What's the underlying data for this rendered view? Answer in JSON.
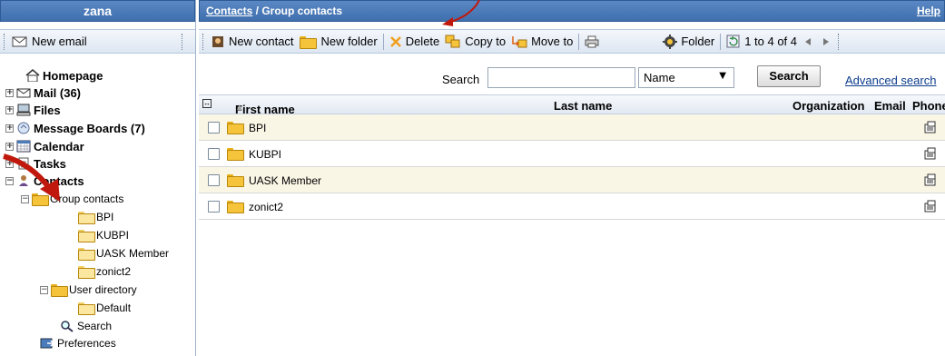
{
  "left_panel": {
    "brand": "zana",
    "toolbar": {
      "new_email": "New email"
    },
    "tree": [
      {
        "label": "Homepage"
      },
      {
        "label": "Mail (36)"
      },
      {
        "label": "Files"
      },
      {
        "label": "Message Boards (7)"
      },
      {
        "label": "Calendar"
      },
      {
        "label": "Tasks"
      },
      {
        "label": "Contacts"
      },
      {
        "label": "Group contacts"
      },
      {
        "label": "BPI"
      },
      {
        "label": "KUBPI"
      },
      {
        "label": "UASK Member"
      },
      {
        "label": "zonict2"
      },
      {
        "label": "User directory"
      },
      {
        "label": "Default"
      },
      {
        "label": "Search"
      },
      {
        "label": "Preferences"
      }
    ]
  },
  "header": {
    "breadcrumb_link": "Contacts",
    "breadcrumb_rest": " / Group contacts",
    "help": "Help"
  },
  "toolbar": {
    "new_contact": "New contact",
    "new_folder": "New folder",
    "delete": "Delete",
    "copy_to": "Copy to",
    "move_to": "Move to",
    "folder": "Folder",
    "paging": "1 to 4 of 4"
  },
  "search": {
    "label": "Search",
    "value": "",
    "field_selected": "Name",
    "button": "Search",
    "advanced": "Advanced search"
  },
  "table": {
    "columns": [
      "First name",
      "Last name",
      "Organization",
      "Email",
      "Phone"
    ],
    "rows": [
      {
        "first_name": "BPI"
      },
      {
        "first_name": "KUBPI"
      },
      {
        "first_name": "UASK Member"
      },
      {
        "first_name": "zonict2"
      }
    ]
  },
  "colors": {
    "header_blue": "#4a7cbb",
    "arrow_red": "#c0180c",
    "folder_yellow": "#f6c43a",
    "row_alt": "#faf6e6"
  }
}
